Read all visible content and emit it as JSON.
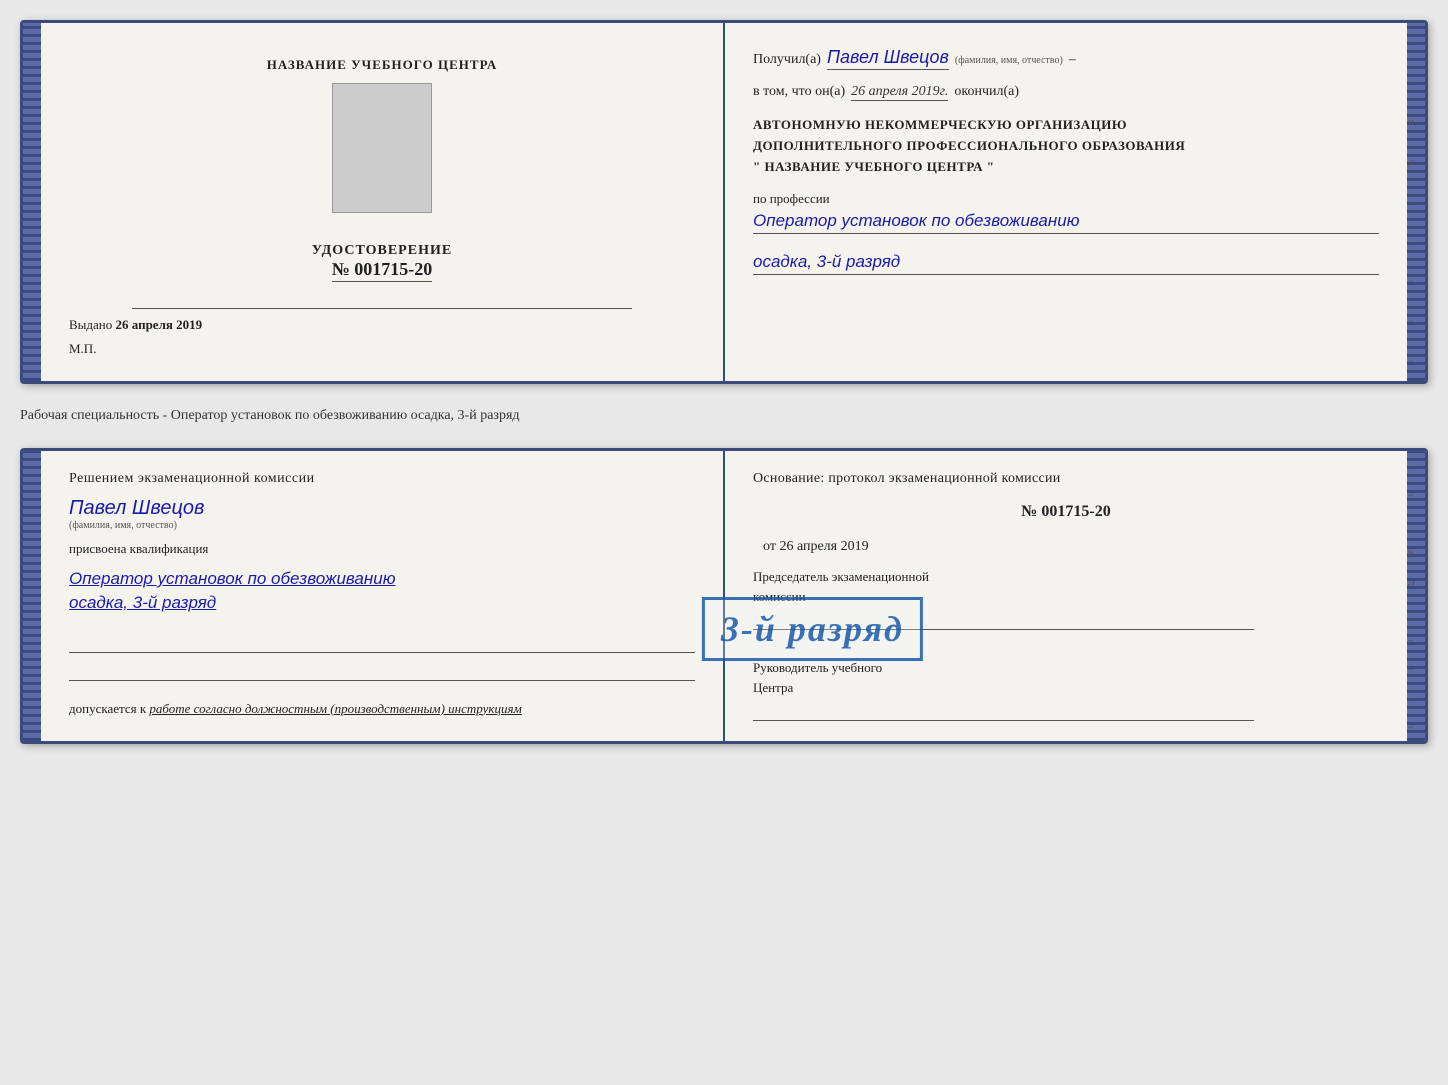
{
  "top_document": {
    "left": {
      "center_title": "НАЗВАНИЕ УЧЕБНОГО ЦЕНТРА",
      "cert_label": "УДОСТОВЕРЕНИЕ",
      "cert_number_prefix": "№",
      "cert_number": "001715-20",
      "issued_prefix": "Выдано",
      "issued_date": "26 апреля 2019",
      "mp_label": "М.П."
    },
    "right": {
      "received_prefix": "Получил(а)",
      "recipient_name": "Павел Швецов",
      "recipient_subtitle": "(фамилия, имя, отчество)",
      "dash": "–",
      "in_that_prefix": "в том, что он(а)",
      "completed_date": "26 апреля 2019г.",
      "completed_suffix": "окончил(а)",
      "org_line1": "АВТОНОМНУЮ НЕКОММЕРЧЕСКУЮ ОРГАНИЗАЦИЮ",
      "org_line2": "ДОПОЛНИТЕЛЬНОГО ПРОФЕССИОНАЛЬНОГО ОБРАЗОВАНИЯ",
      "org_line3": "\"  НАЗВАНИЕ УЧЕБНОГО ЦЕНТРА  \"",
      "profession_label": "по профессии",
      "profession_value": "Оператор установок по обезвоживанию",
      "rank_value": "осадка, 3-й разряд"
    }
  },
  "separator": {
    "text": "Рабочая специальность - Оператор установок по обезвоживанию осадка, 3-й разряд"
  },
  "bottom_document": {
    "left": {
      "decision_text": "Решением экзаменационной комиссии",
      "person_name": "Павел Швецов",
      "person_subtitle": "(фамилия, имя, отчество)",
      "qualification_label": "присвоена квалификация",
      "qualification_value1": "Оператор установок по обезвоживанию",
      "qualification_value2": "осадка, 3-й разряд",
      "allowed_prefix": "допускается к",
      "allowed_italic": "работе согласно должностным (производственным) инструкциям"
    },
    "right": {
      "basis_text": "Основание: протокол экзаменационной комиссии",
      "protocol_number": "№  001715-20",
      "date_prefix": "от",
      "protocol_date": "26 апреля 2019",
      "chairman_line1": "Председатель экзаменационной",
      "chairman_line2": "комиссии",
      "director_line1": "Руководитель учебного",
      "director_line2": "Центра"
    },
    "stamp": {
      "text": "3-й разряд"
    }
  },
  "right_markers": {
    "items": [
      "–",
      "–",
      "и",
      ",а",
      "←",
      "–",
      "–",
      "–",
      "–"
    ]
  }
}
